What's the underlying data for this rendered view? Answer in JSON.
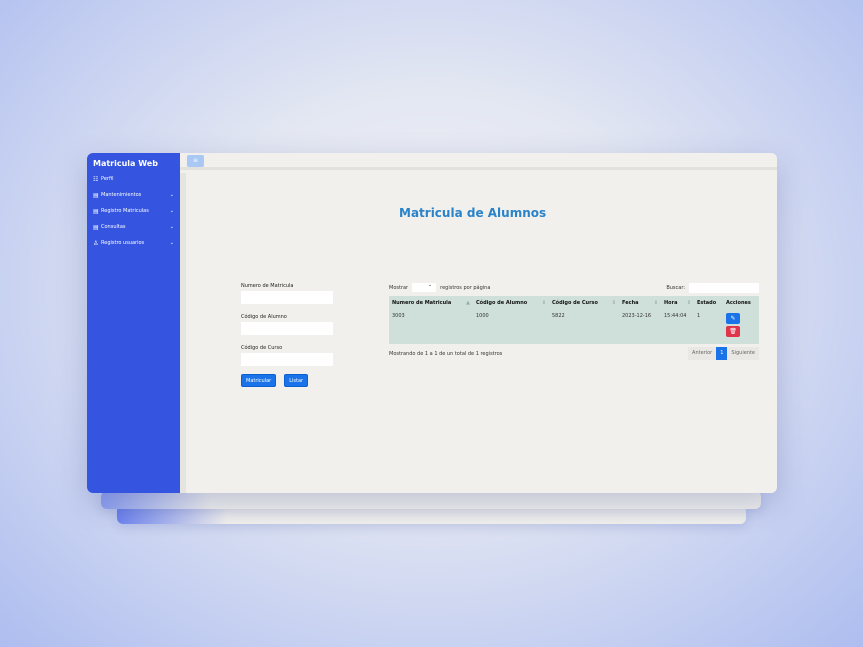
{
  "sidebar": {
    "brand": "Matricula Web",
    "items": [
      {
        "icon": "list-icon",
        "glyph": "☷",
        "label": "Perfil",
        "chevron": ""
      },
      {
        "icon": "document-icon",
        "glyph": "▤",
        "label": "Mantenimientos",
        "chevron": "⌄"
      },
      {
        "icon": "document-icon",
        "glyph": "▤",
        "label": "Registro Matriculas",
        "chevron": "⌄"
      },
      {
        "icon": "document-icon",
        "glyph": "▤",
        "label": "Consultas",
        "chevron": "⌄"
      },
      {
        "icon": "user-icon",
        "glyph": "♙",
        "label": "Registro usuarios",
        "chevron": "⌄"
      }
    ]
  },
  "topbar": {
    "toggle_glyph": "≡"
  },
  "main": {
    "title": "Matricula de Alumnos"
  },
  "form": {
    "matricula_label": "Numero de Matricula",
    "alumno_label": "Código de Alumno",
    "curso_label": "Código de Curso",
    "matricula_value": "",
    "alumno_value": "",
    "curso_value": "",
    "matricular_button": "Matricular",
    "listar_button": "Listar"
  },
  "table": {
    "show_label": "Mostrar",
    "per_page_label": "registros por página",
    "search_label": "Buscar:",
    "columns": [
      "Numero de Matricula",
      "Código de Alumno",
      "Código de Curso",
      "Fecha",
      "Hora",
      "Estado",
      "Acciones"
    ],
    "rows": [
      {
        "matricula": "3003",
        "alumno": "1000",
        "curso": "5822",
        "fecha": "2023-12-16",
        "hora": "15:44:04",
        "estado": "1"
      }
    ],
    "info": "Mostrando de 1 a 1 de un total de 1 registros",
    "prev": "Anterior",
    "page": "1",
    "next": "Siguiente"
  }
}
